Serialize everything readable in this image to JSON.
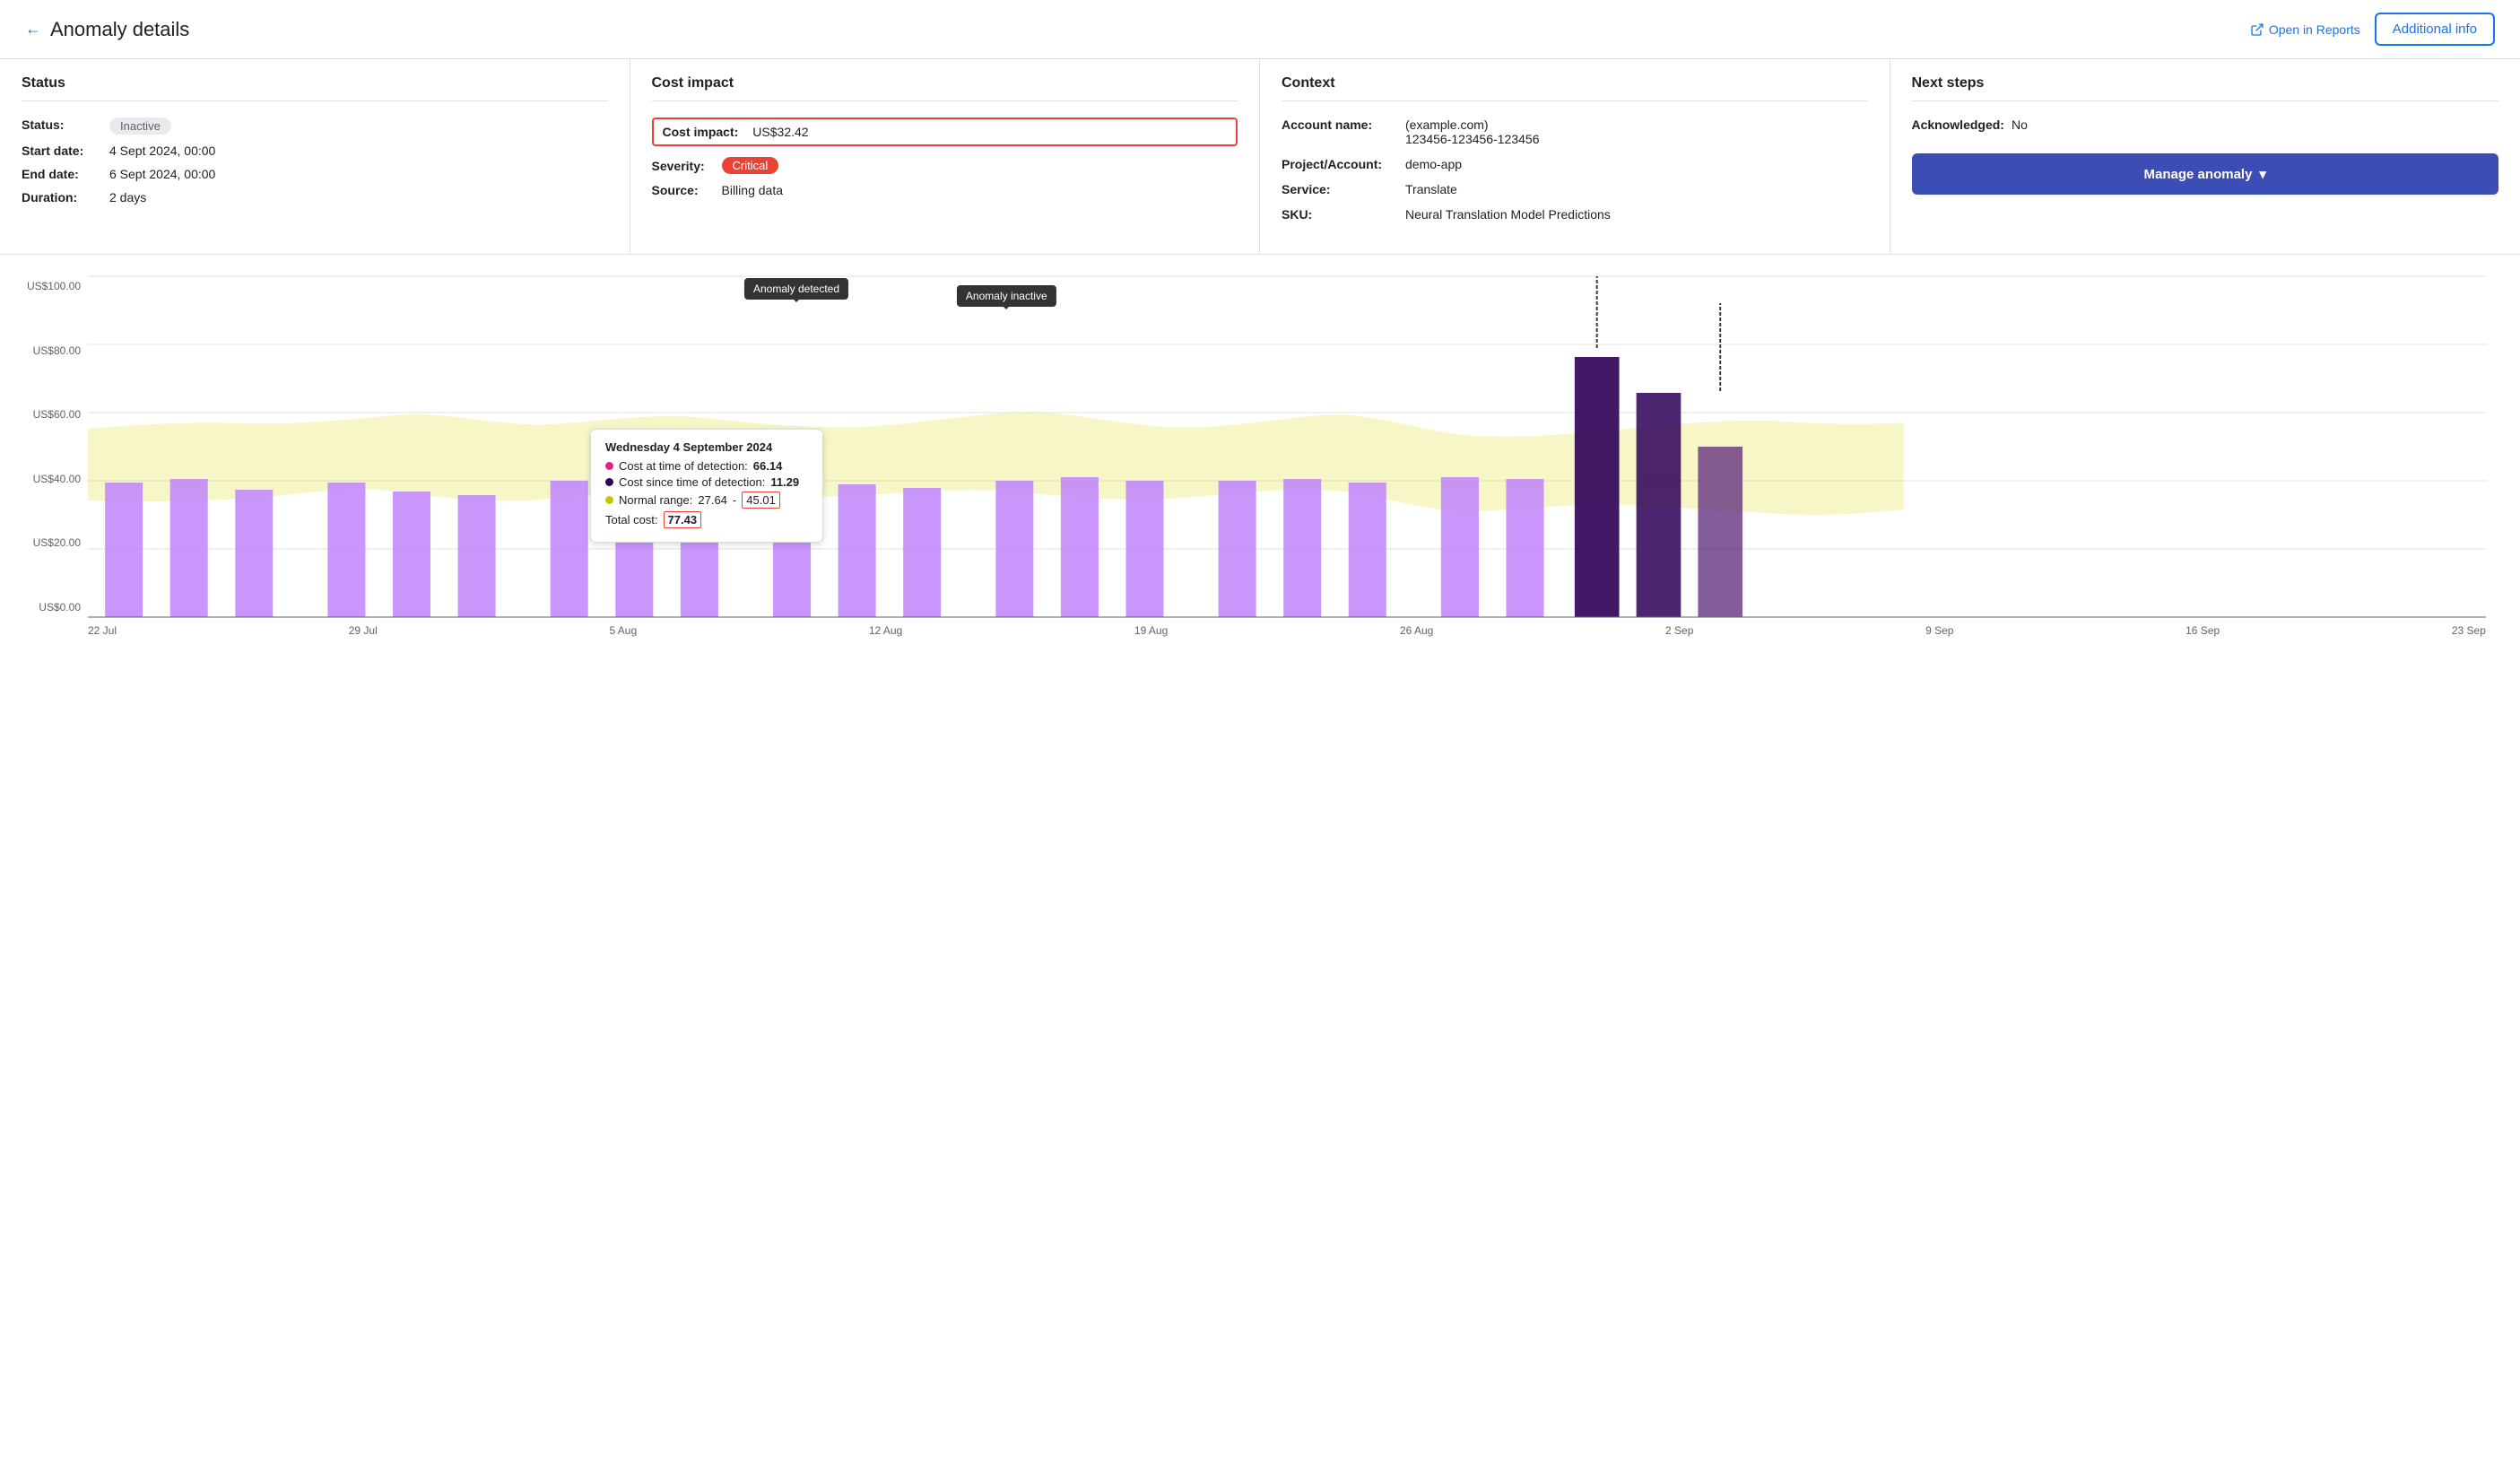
{
  "header": {
    "back_label": "←",
    "title": "Anomaly details",
    "open_reports_label": "Open in Reports",
    "additional_info_label": "Additional info"
  },
  "status_card": {
    "title": "Status",
    "fields": [
      {
        "label": "Status:",
        "value": "Inactive",
        "type": "badge-inactive"
      },
      {
        "label": "Start date:",
        "value": "4 Sept 2024, 00:00",
        "type": "text"
      },
      {
        "label": "End date:",
        "value": "6 Sept 2024, 00:00",
        "type": "text"
      },
      {
        "label": "Duration:",
        "value": "2 days",
        "type": "text"
      }
    ]
  },
  "cost_impact_card": {
    "title": "Cost impact",
    "cost_impact_label": "Cost impact:",
    "cost_impact_value": "US$32.42",
    "severity_label": "Severity:",
    "severity_value": "Critical",
    "source_label": "Source:",
    "source_value": "Billing data"
  },
  "context_card": {
    "title": "Context",
    "fields": [
      {
        "label": "Account name:",
        "value": "(example.com)\n123456-123456-123456"
      },
      {
        "label": "Project/Account:",
        "value": "demo-app"
      },
      {
        "label": "Service:",
        "value": "Translate"
      },
      {
        "label": "SKU:",
        "value": "Neural Translation Model Predictions"
      }
    ]
  },
  "next_steps_card": {
    "title": "Next steps",
    "acknowledged_label": "Acknowledged:",
    "acknowledged_value": "No",
    "manage_btn_label": "Manage anomaly"
  },
  "chart": {
    "y_labels": [
      "US$100.00",
      "US$80.00",
      "US$60.00",
      "US$40.00",
      "US$20.00",
      "US$0.00"
    ],
    "x_labels": [
      "22 Jul",
      "29 Jul",
      "5 Aug",
      "12 Aug",
      "19 Aug",
      "26 Aug",
      "2 Sep",
      "9 Sep",
      "16 Sep",
      "23 Sep"
    ],
    "tooltip": {
      "date": "Wednesday 4 September 2024",
      "cost_at_detection_label": "Cost at time of detection:",
      "cost_at_detection_value": "66.14",
      "cost_since_label": "Cost since time of detection:",
      "cost_since_value": "11.29",
      "normal_range_label": "Normal range:",
      "normal_range_low": "27.64",
      "normal_range_high": "45.01",
      "total_label": "Total cost:",
      "total_value": "77.43"
    },
    "anomaly_detected_label": "Anomaly detected",
    "anomaly_inactive_label": "Anomaly inactive"
  }
}
